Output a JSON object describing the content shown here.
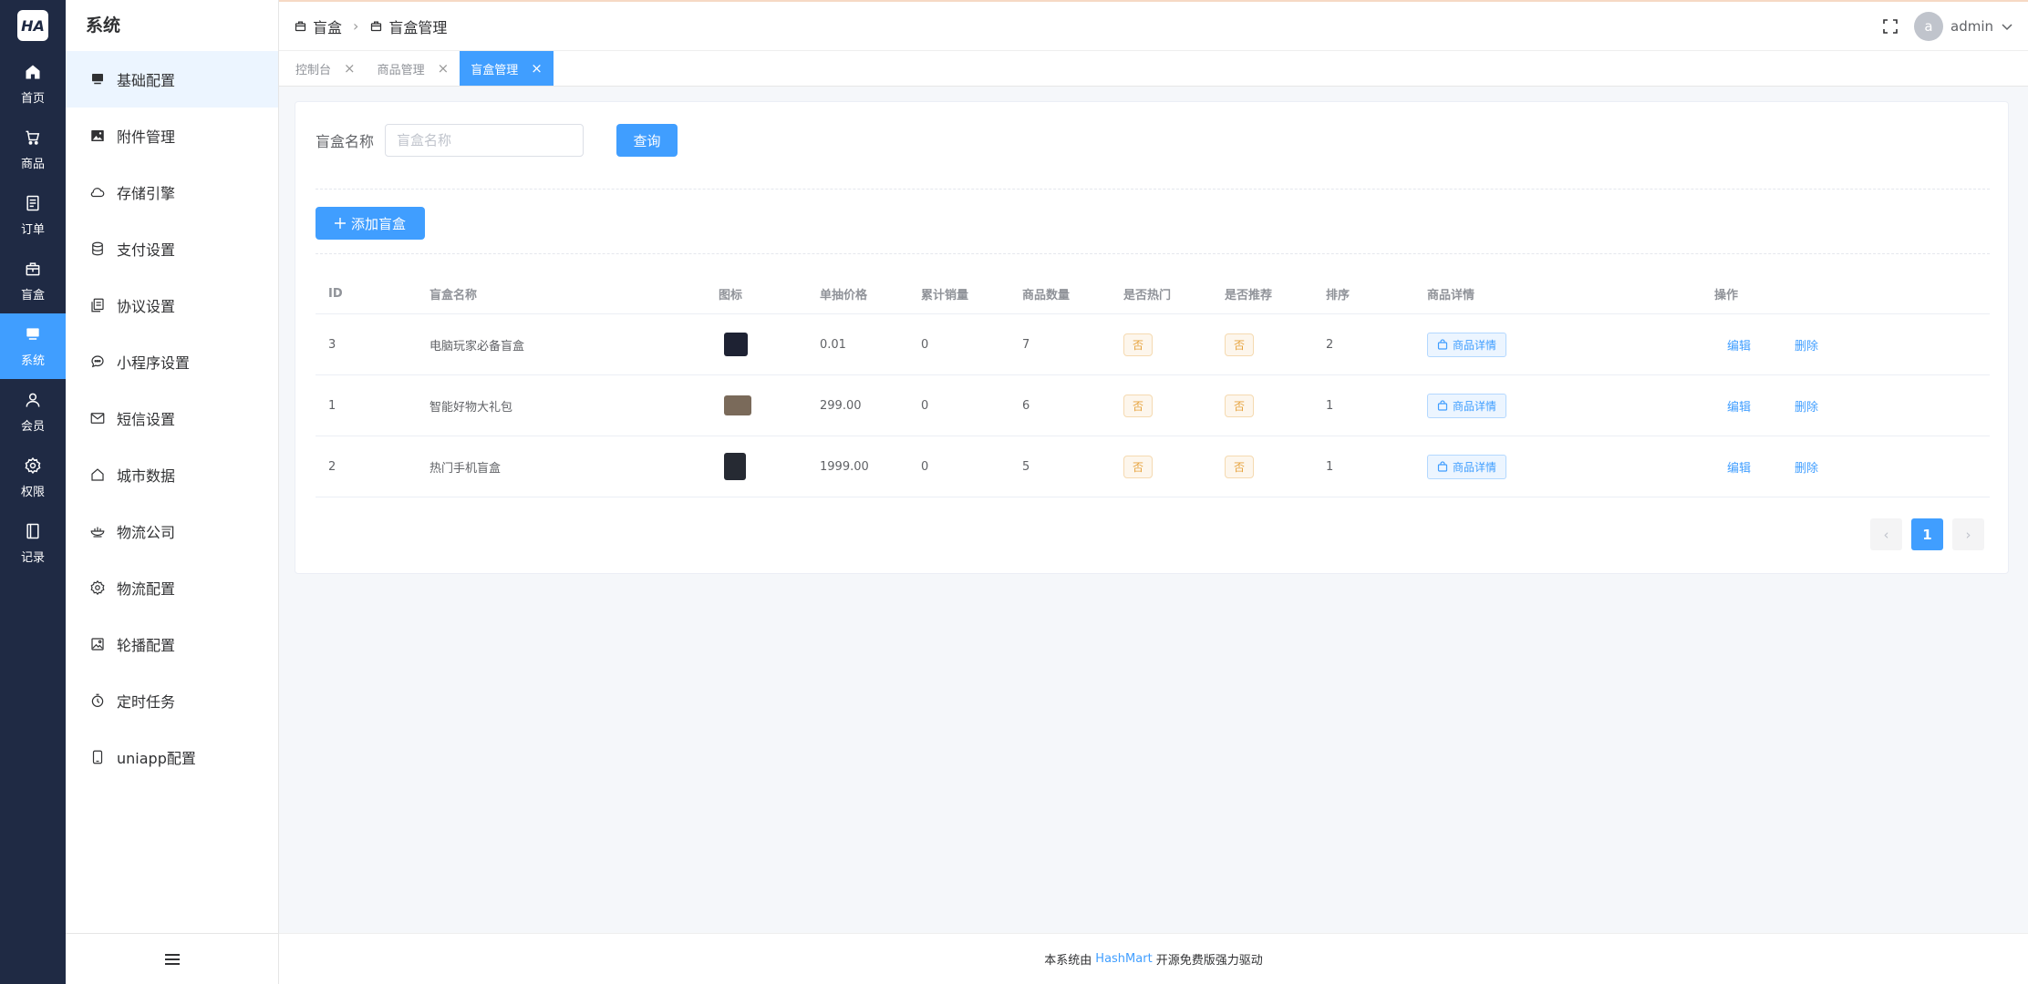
{
  "logo": {
    "text": "HA"
  },
  "rail": [
    {
      "key": "home",
      "label": "首页",
      "icon": "home-icon",
      "active": false
    },
    {
      "key": "goods",
      "label": "商品",
      "icon": "cart-icon",
      "active": false
    },
    {
      "key": "order",
      "label": "订单",
      "icon": "document-icon",
      "active": false
    },
    {
      "key": "blindbox",
      "label": "盲盒",
      "icon": "gift-box-icon",
      "active": false
    },
    {
      "key": "system",
      "label": "系统",
      "icon": "monitor-icon",
      "active": true
    },
    {
      "key": "member",
      "label": "会员",
      "icon": "user-icon",
      "active": false
    },
    {
      "key": "permission",
      "label": "权限",
      "icon": "gear-icon",
      "active": false
    },
    {
      "key": "record",
      "label": "记录",
      "icon": "notebook-icon",
      "active": false
    }
  ],
  "sidebar": {
    "title": "系统",
    "items": [
      {
        "label": "基础配置",
        "icon": "monitor-icon",
        "active": true
      },
      {
        "label": "附件管理",
        "icon": "image-icon",
        "active": false
      },
      {
        "label": "存储引擎",
        "icon": "cloud-icon",
        "active": false
      },
      {
        "label": "支付设置",
        "icon": "coins-icon",
        "active": false
      },
      {
        "label": "协议设置",
        "icon": "copy-document-icon",
        "active": false
      },
      {
        "label": "小程序设置",
        "icon": "chat-icon",
        "active": false
      },
      {
        "label": "短信设置",
        "icon": "mail-icon",
        "active": false
      },
      {
        "label": "城市数据",
        "icon": "house-icon",
        "active": false
      },
      {
        "label": "物流公司",
        "icon": "bowl-icon",
        "active": false
      },
      {
        "label": "物流配置",
        "icon": "gear-icon",
        "active": false
      },
      {
        "label": "轮播配置",
        "icon": "picture-icon",
        "active": false
      },
      {
        "label": "定时任务",
        "icon": "stopwatch-icon",
        "active": false
      },
      {
        "label": "uniapp配置",
        "icon": "phone-icon",
        "active": false
      }
    ]
  },
  "header": {
    "breadcrumb": [
      "盲盒",
      "盲盒管理"
    ],
    "user": {
      "avatar": "a",
      "name": "admin"
    }
  },
  "tabs": [
    {
      "label": "控制台",
      "active": false
    },
    {
      "label": "商品管理",
      "active": false
    },
    {
      "label": "盲盒管理",
      "active": true
    }
  ],
  "search": {
    "label": "盲盒名称",
    "placeholder": "盲盒名称",
    "value": "",
    "query_label": "查询"
  },
  "add_button": {
    "label": "添加盲盒",
    "icon": "plus-icon"
  },
  "table": {
    "columns": [
      "ID",
      "盲盒名称",
      "图标",
      "单抽价格",
      "累计销量",
      "商品数量",
      "是否热门",
      "是否推荐",
      "排序",
      "商品详情",
      "操作"
    ],
    "rows": [
      {
        "id": "3",
        "name": "电脑玩家必备盲盒",
        "thumb_color": "#1e2233",
        "price": "0.01",
        "sales": "0",
        "qty": "7",
        "hot": "否",
        "recommend": "否",
        "sort": "2",
        "detail": "商品详情",
        "edit": "编辑",
        "delete": "删除"
      },
      {
        "id": "1",
        "name": "智能好物大礼包",
        "thumb_color": "#7a6a5a",
        "price": "299.00",
        "sales": "0",
        "qty": "6",
        "hot": "否",
        "recommend": "否",
        "sort": "1",
        "detail": "商品详情",
        "edit": "编辑",
        "delete": "删除"
      },
      {
        "id": "2",
        "name": "热门手机盲盒",
        "thumb_color": "#262a33",
        "price": "1999.00",
        "sales": "0",
        "qty": "5",
        "hot": "否",
        "recommend": "否",
        "sort": "1",
        "detail": "商品详情",
        "edit": "编辑",
        "delete": "删除"
      }
    ]
  },
  "pagination": {
    "prev": "‹",
    "current": "1",
    "next": "›"
  },
  "footer": {
    "prefix": "本系统由",
    "link": "HashMart",
    "suffix": "开源免费版强力驱动"
  },
  "colors": {
    "primary": "#409eff",
    "rail_bg": "#1f2a44",
    "tag_warning": "#e6a23c"
  }
}
